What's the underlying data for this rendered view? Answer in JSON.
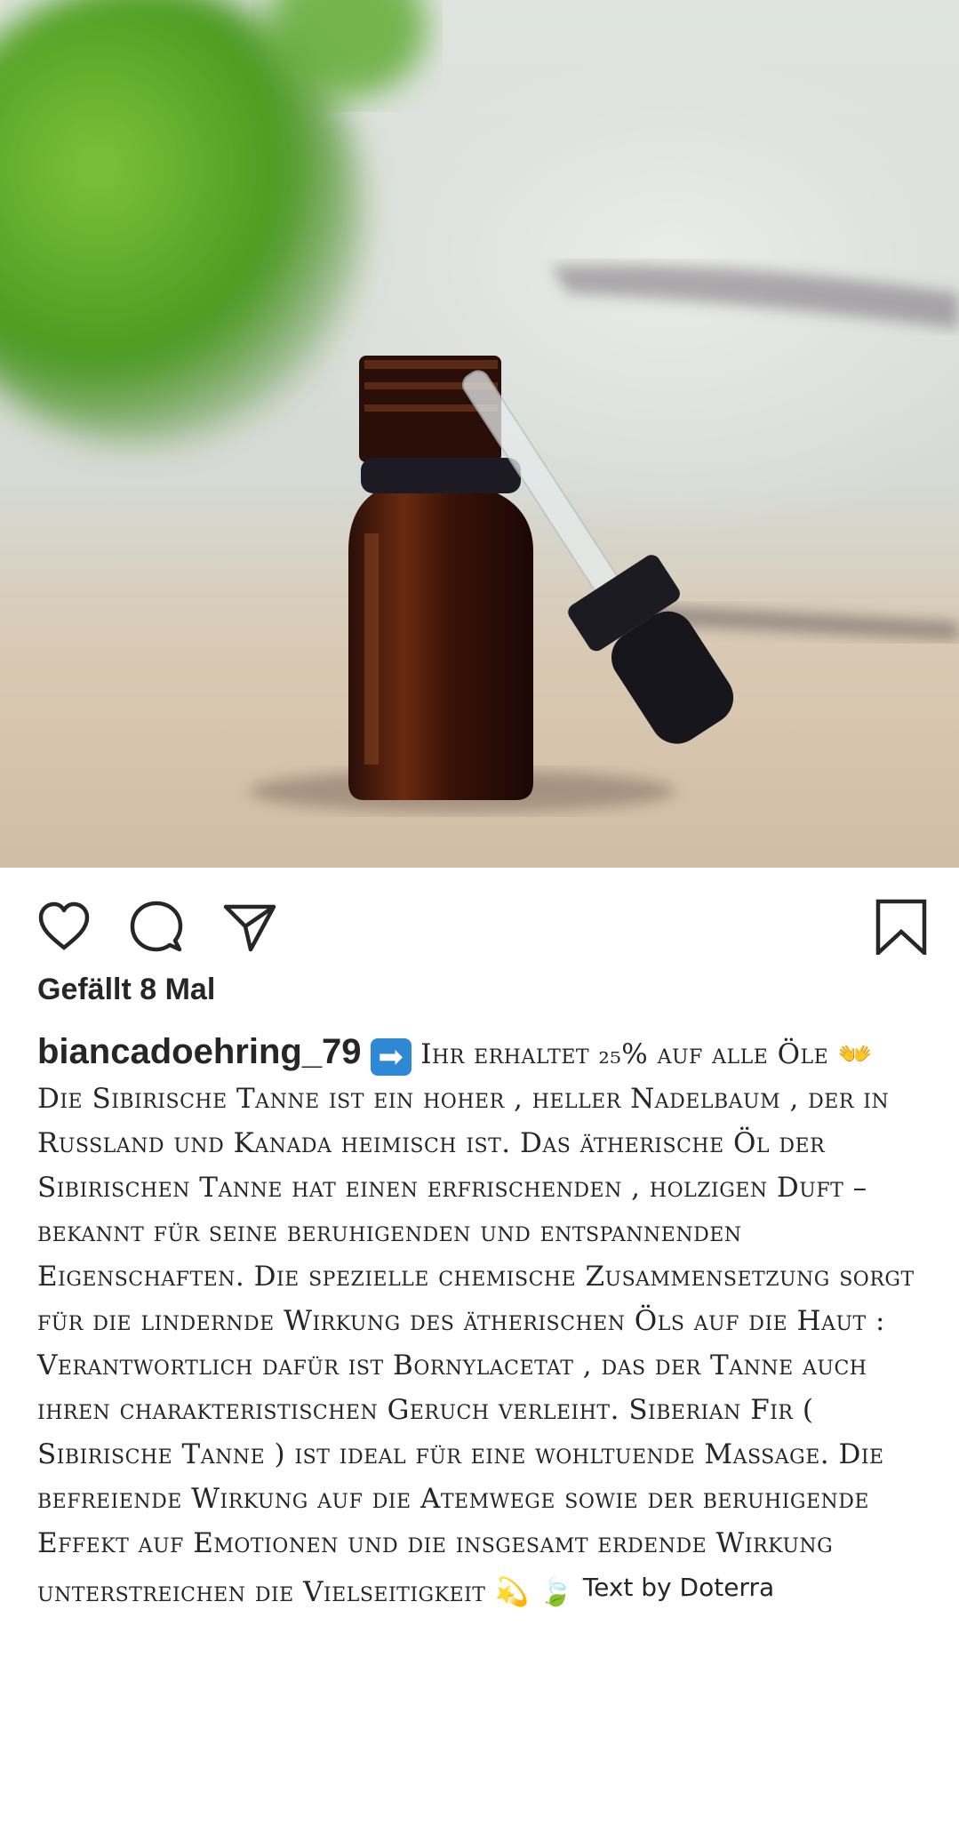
{
  "post": {
    "image_alt_icon": "essential-oil-bottle-photo",
    "likes_text": "Gefällt 8 Mal",
    "username": "biancadoehring_79",
    "arrow_emoji": "➡",
    "caption_line1": "Ihr erhaltet ₂₅% auf alle Öle",
    "hands_emoji": "👐",
    "caption_body": "Die Sibirische Tanne ist ein hoher , heller Nadelbaum , der in Russland und Kanada heimisch ist. Das ätherische Öl der Sibirischen Tanne hat einen erfrischenden , holzigen Duft – bekannt für seine beruhigenden und entspannenden Eigenschaften. Die spezielle chemische Zusammensetzung sorgt für die lindernde Wirkung des ätherischen Öls auf die Haut : Verantwortlich dafür ist Bornylacetat , das der Tanne auch ihren charakteristischen Geruch verleiht. Siberian Fir ( Sibirische Tanne ) ist ideal für eine wohltuende Massage. Die befreiende Wirkung auf die Atemwege sowie der beruhigende Effekt auf Emotionen und die insgesamt erdende Wirkung unterstreichen die Vielseitigkeit",
    "sparkle_emoji": "💫",
    "leaf_emoji": "🍃",
    "credit": "Text by Doterra"
  },
  "icons": {
    "like": "heart-icon",
    "comment": "comment-icon",
    "share": "send-icon",
    "save": "bookmark-icon"
  },
  "colors": {
    "text": "#262626",
    "background": "#ffffff"
  }
}
